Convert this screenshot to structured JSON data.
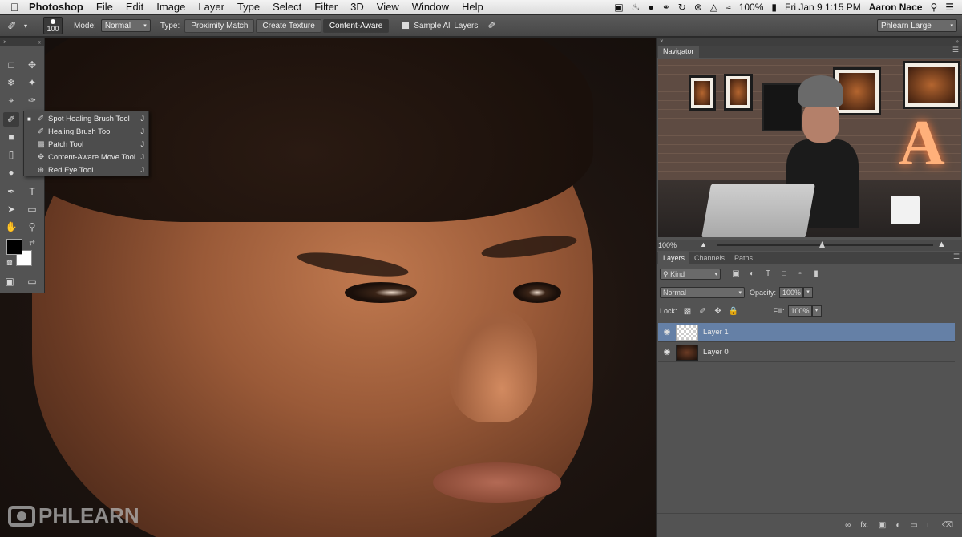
{
  "menubar": {
    "apple": "",
    "app_name": "Photoshop",
    "menus": [
      "File",
      "Edit",
      "Image",
      "Layer",
      "Type",
      "Select",
      "Filter",
      "3D",
      "View",
      "Window",
      "Help"
    ],
    "battery": "100%",
    "datetime": "Fri Jan 9  1:15 PM",
    "user": "Aaron Nace"
  },
  "options_bar": {
    "brush_size": "100",
    "mode_label": "Mode:",
    "mode_value": "Normal",
    "type_label": "Type:",
    "type_options": [
      "Proximity Match",
      "Create Texture",
      "Content-Aware"
    ],
    "sample_all_layers": "Sample All Layers",
    "workspace": "Phlearn Large"
  },
  "flyout": {
    "items": [
      {
        "label": "Spot Healing Brush Tool",
        "key": "J",
        "active": true
      },
      {
        "label": "Healing Brush Tool",
        "key": "J"
      },
      {
        "label": "Patch Tool",
        "key": "J"
      },
      {
        "label": "Content-Aware Move Tool",
        "key": "J"
      },
      {
        "label": "Red Eye Tool",
        "key": "J"
      }
    ]
  },
  "navigator": {
    "tab": "Navigator",
    "zoom": "100%"
  },
  "layers_panel": {
    "tabs": [
      "Layers",
      "Channels",
      "Paths"
    ],
    "filter_kind": "Kind",
    "blend_mode": "Normal",
    "opacity_label": "Opacity:",
    "opacity_value": "100%",
    "lock_label": "Lock:",
    "fill_label": "Fill:",
    "fill_value": "100%",
    "layers": [
      {
        "name": "Layer 1",
        "selected": true
      },
      {
        "name": "Layer 0",
        "selected": false
      }
    ]
  },
  "watermark": "PHLEARN",
  "colors": {
    "selected_layer": "#6580a6",
    "panel_bg": "#535353"
  }
}
